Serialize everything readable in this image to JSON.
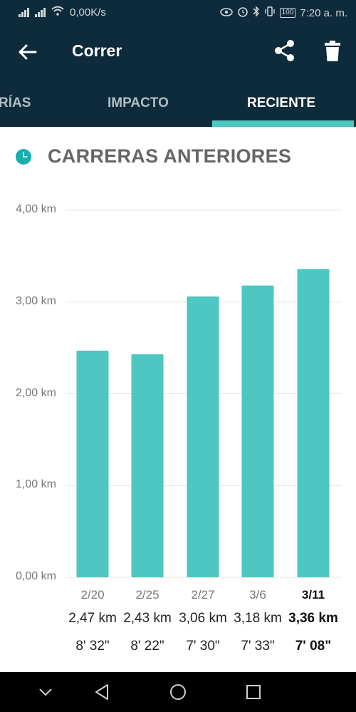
{
  "status_bar": {
    "speed": "0,00K/s",
    "battery": "100",
    "time": "7:20 a. m."
  },
  "app_bar": {
    "title": "Correr"
  },
  "tabs": [
    {
      "label": "RÍAS",
      "active": false
    },
    {
      "label": "IMPACTO",
      "active": false
    },
    {
      "label": "RECIENTE",
      "active": true
    }
  ],
  "section": {
    "title": "CARRERAS ANTERIORES"
  },
  "colors": {
    "header_bg": "#0d2b3b",
    "accent": "#4ec6c2"
  },
  "chart_data": {
    "type": "bar",
    "categories": [
      "2/20",
      "2/25",
      "2/27",
      "3/6",
      "3/11"
    ],
    "values": [
      2.47,
      2.43,
      3.06,
      3.18,
      3.36
    ],
    "distance_labels": [
      "2,47 km",
      "2,43 km",
      "3,06 km",
      "3,18 km",
      "3,36 km"
    ],
    "pace_labels": [
      "8' 32\"",
      "8' 22\"",
      "7' 30\"",
      "7' 33\"",
      "7' 08\""
    ],
    "highlighted_index": 4,
    "y_ticks": [
      "0,00 km",
      "1,00 km",
      "2,00 km",
      "3,00 km",
      "4,00 km"
    ],
    "ylim": [
      0,
      4
    ],
    "grid": true,
    "bar_color": "#4ec6c2"
  }
}
